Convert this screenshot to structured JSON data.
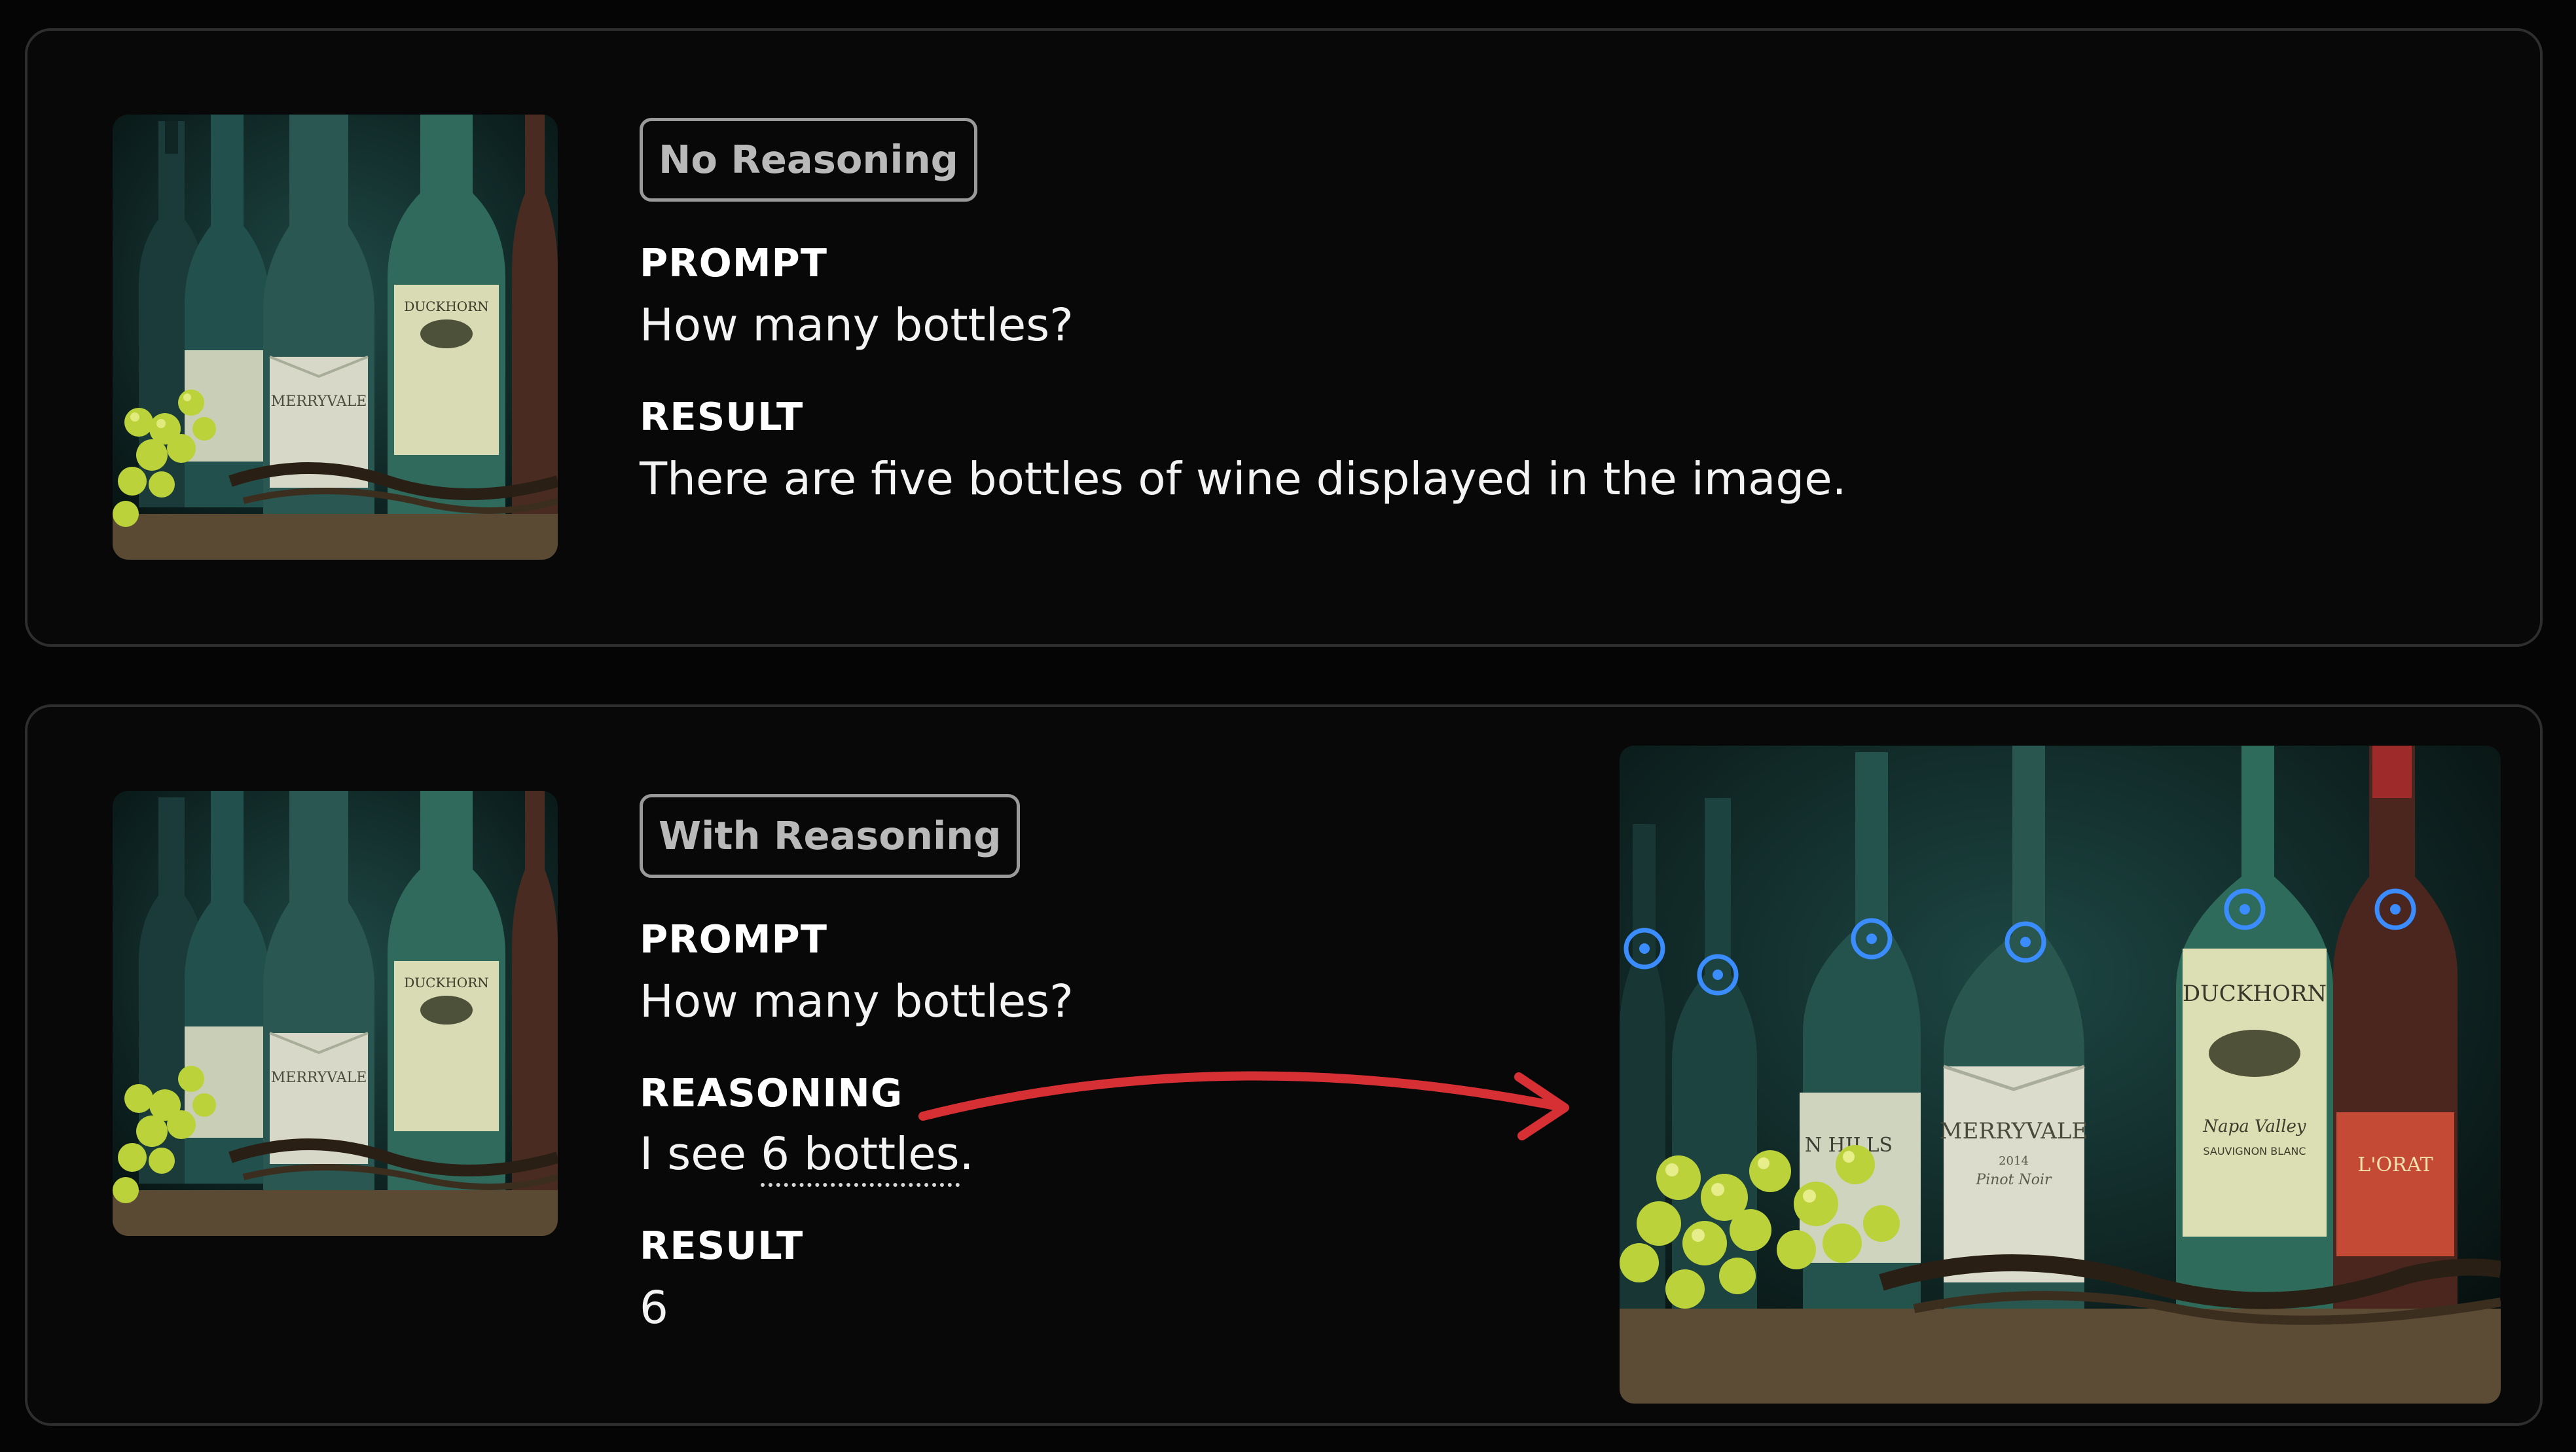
{
  "cards": [
    {
      "badge": "No Reasoning",
      "prompt_label": "PROMPT",
      "prompt": "How many bottles?",
      "result_label": "RESULT",
      "result": "There are five bottles of wine displayed in the image."
    },
    {
      "badge": "With Reasoning",
      "prompt_label": "PROMPT",
      "prompt": "How many bottles?",
      "reasoning_label": "REASONING",
      "reasoning_prefix": "I see ",
      "reasoning_highlight": "6 bottles",
      "reasoning_suffix": ".",
      "result_label": "RESULT",
      "result": "6"
    }
  ],
  "colors": {
    "background": "#050505",
    "card_border": "#2e2e2e",
    "arrow": "#d62f34",
    "point_marker": "#3a8cff"
  },
  "image_labels": {
    "merryvale": "MERRYVALE",
    "duckhorn": "DUCKHORN",
    "hills": "N HILLS",
    "napa": "Napa Valley",
    "sauvignon": "SAUVIGNON BLANC",
    "pinot": "Pinot Noir",
    "lorat": "L'ORAT"
  },
  "point_markers_count": 6
}
